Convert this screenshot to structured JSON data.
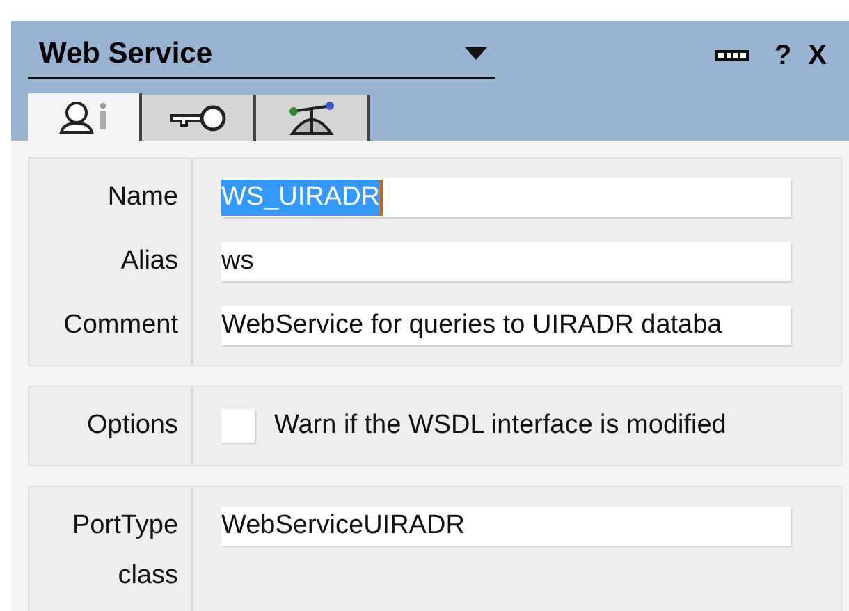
{
  "panel": {
    "title": "Web Service"
  },
  "toolbar": [
    "?",
    "X"
  ],
  "tabs": [
    {
      "kind": "info",
      "selected": true
    },
    {
      "kind": "key",
      "selected": false
    },
    {
      "kind": "network",
      "selected": false
    }
  ],
  "groups": [
    {
      "fields": [
        {
          "kind": "text",
          "label": "Name",
          "value": "WS_UIRADR",
          "selected": true
        },
        {
          "kind": "text",
          "label": "Alias",
          "value": "ws",
          "selected": false
        },
        {
          "kind": "text",
          "label": "Comment",
          "value": "WebService for queries to UIRADR databa",
          "selected": false
        }
      ]
    },
    {
      "fields": [
        {
          "kind": "checkbox",
          "label": "Options",
          "text": "Warn if the WSDL interface is modified",
          "checked": false
        }
      ]
    },
    {
      "fields": [
        {
          "kind": "text",
          "label": "PortType class",
          "value": "WebServiceUIRADR",
          "selected": false
        }
      ]
    }
  ]
}
